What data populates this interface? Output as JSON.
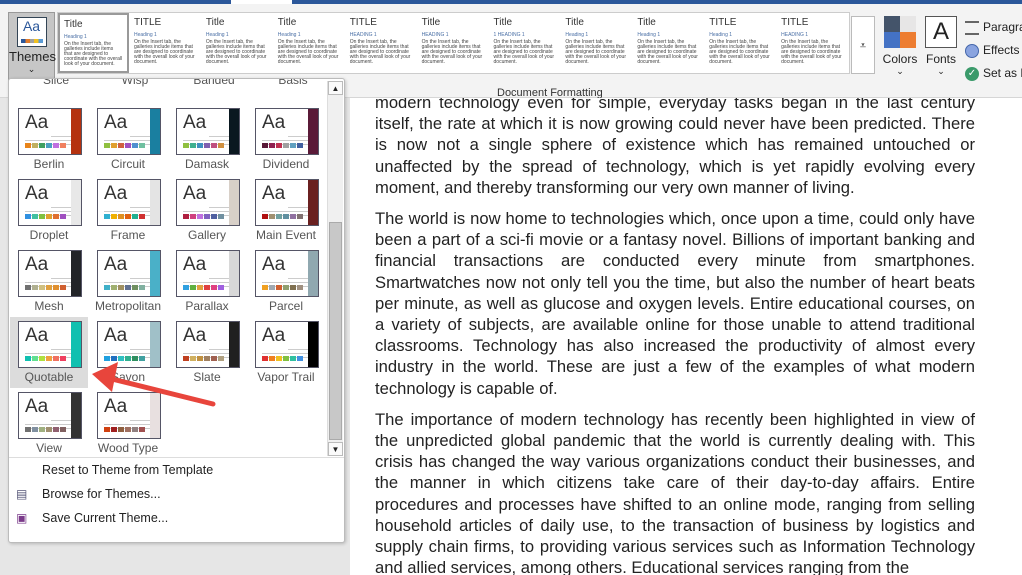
{
  "ribbon": {
    "themes_label": "Themes",
    "gallery": [
      {
        "title": "Title",
        "heading": "Heading 1"
      },
      {
        "title": "TITLE",
        "heading": "Heading 1"
      },
      {
        "title": "Title",
        "heading": "Heading 1"
      },
      {
        "title": "Title",
        "heading": "Heading 1"
      },
      {
        "title": "TITLE",
        "heading": "HEADING 1"
      },
      {
        "title": "Title",
        "heading": "HEADING 1"
      },
      {
        "title": "Title",
        "heading": "1 HEADING 1"
      },
      {
        "title": "Title",
        "heading": "Heading 1"
      },
      {
        "title": "Title",
        "heading": "Heading 1"
      },
      {
        "title": "TITLE",
        "heading": "Heading 1"
      },
      {
        "title": "TITLE",
        "heading": "HEADING 1"
      }
    ],
    "sample_body": "On the Insert tab, the galleries include items that are designed to coordinate with the overall look of your document.",
    "colors_label": "Colors",
    "fonts_label": "Fonts",
    "fonts_glyph": "A",
    "paragraph_spacing": "Paragra",
    "effects": "Effects",
    "set_default": "Set as D",
    "group_name": "Document Formatting"
  },
  "themes_panel": {
    "partial_row": [
      "Slice",
      "Wisp",
      "Banded",
      "Basis"
    ],
    "themes": [
      {
        "name": "Berlin",
        "side": "#b5320f",
        "colors": [
          "#e8841a",
          "#c0b060",
          "#40a060",
          "#4aa0c0",
          "#c070e0",
          "#f08060"
        ]
      },
      {
        "name": "Circuit",
        "side": "#1a7fa0",
        "colors": [
          "#90c040",
          "#e0a030",
          "#d06040",
          "#a050c0",
          "#5090d0",
          "#70c0a0"
        ]
      },
      {
        "name": "Damask",
        "side": "#0a1820",
        "colors": [
          "#90c040",
          "#40b090",
          "#4090c0",
          "#8060b0",
          "#c05080",
          "#d09040"
        ]
      },
      {
        "name": "Dividend",
        "side": "#5a1a38",
        "colors": [
          "#5a1a38",
          "#902050",
          "#c03050",
          "#a0a0a0",
          "#60a0c0",
          "#4060a0"
        ]
      },
      {
        "name": "Droplet",
        "side": "#e8e8e8",
        "colors": [
          "#3090e0",
          "#40c0a0",
          "#80c040",
          "#e0a030",
          "#e07030",
          "#a050c0"
        ]
      },
      {
        "name": "Frame",
        "side": "#e4e4e4",
        "colors": [
          "#30b0d0",
          "#f0b000",
          "#e09020",
          "#e06010",
          "#20b090",
          "#d03030"
        ]
      },
      {
        "name": "Gallery",
        "side": "#d8d0c8",
        "colors": [
          "#b02040",
          "#d04080",
          "#c070e0",
          "#8060c0",
          "#5060a0",
          "#7090a0"
        ]
      },
      {
        "name": "Main Event",
        "side": "#6a2020",
        "colors": [
          "#b01010",
          "#a09070",
          "#70a0a0",
          "#6090a0",
          "#9070a0",
          "#807070"
        ]
      },
      {
        "name": "Mesh",
        "side": "#222428",
        "colors": [
          "#707070",
          "#b0b090",
          "#d0c080",
          "#e0a040",
          "#e09030",
          "#d06030"
        ]
      },
      {
        "name": "Metropolitan",
        "side": "#4ab0c8",
        "colors": [
          "#40b0c8",
          "#a0b070",
          "#a09060",
          "#607090",
          "#709060",
          "#80b0a0"
        ]
      },
      {
        "name": "Parallax",
        "side": "#d8d8d8",
        "colors": [
          "#30a0e0",
          "#60b040",
          "#e0a040",
          "#e04040",
          "#e04080",
          "#a060e0"
        ]
      },
      {
        "name": "Parcel",
        "side": "#90a8b0",
        "colors": [
          "#f0a020",
          "#a0a8b0",
          "#d06030",
          "#90a070",
          "#807050",
          "#a09080"
        ]
      },
      {
        "name": "Quotable",
        "side": "#10c0b0",
        "colors": [
          "#10c0b0",
          "#60e090",
          "#b0e040",
          "#f0a040",
          "#f07060",
          "#f04060"
        ],
        "selected": true
      },
      {
        "name": "Savon",
        "side": "#a0c0c8",
        "colors": [
          "#20a0e0",
          "#2070c0",
          "#30c0c0",
          "#30b090",
          "#309060",
          "#40a0a0"
        ]
      },
      {
        "name": "Slate",
        "side": "#202020",
        "colors": [
          "#c04020",
          "#d0b060",
          "#c09040",
          "#a08060",
          "#a06050",
          "#b0a080"
        ]
      },
      {
        "name": "Vapor Trail",
        "side": "#000000",
        "colors": [
          "#e03030",
          "#f08020",
          "#f0c020",
          "#80c040",
          "#30c0a0",
          "#4090e0"
        ]
      },
      {
        "name": "View",
        "side": "#333333",
        "colors": [
          "#707070",
          "#8090a0",
          "#a0b080",
          "#a09070",
          "#906070",
          "#806060"
        ]
      },
      {
        "name": "Wood Type",
        "side": "#e8e0e0",
        "colors": [
          "#d04010",
          "#a02020",
          "#906040",
          "#a07060",
          "#908080",
          "#a05050"
        ]
      }
    ],
    "menu": [
      "Reset to Theme from Template",
      "Browse for Themes...",
      "Save Current Theme..."
    ]
  },
  "document": {
    "paragraphs": [
      "modern technology even for simple, everyday tasks began in the last century itself, the rate at which it is now growing could never have been predicted. There is now not a single sphere of existence which has remained untouched or unaffected by the spread of technology, which is yet rapidly evolving every moment, and thereby transforming our very own manner of living.",
      "The world is now home to technologies which, once upon a time, could only have been a part of a sci-fi movie or a fantasy novel. Billions of important banking and financial transactions are conducted every minute from smartphones. Smartwatches now not only tell you the time, but also the number of heart beats per minute, as well as glucose and oxygen levels. Entire educational courses, on a variety of subjects, are available online for those unable to attend traditional classrooms. Technology has also increased the productivity of almost every industry in the world. These are just a few of the examples of what modern technology is capable of.",
      "The importance of modern technology has recently been highlighted in view of the unpredicted global pandemic that the world is currently dealing with. This crisis has changed the way various organizations conduct their businesses, and the manner in which citizens take care of their day-to-day affairs. Entire procedures and processes have shifted to an online mode, ranging from selling household articles of daily use, to the transaction of business by logistics and supply chain firms, to providing various services such as Information Technology and allied services, among others. Educational services ranging from the"
    ]
  },
  "colors": {
    "accent": "#2b579a",
    "arrow": "#e8453c"
  }
}
